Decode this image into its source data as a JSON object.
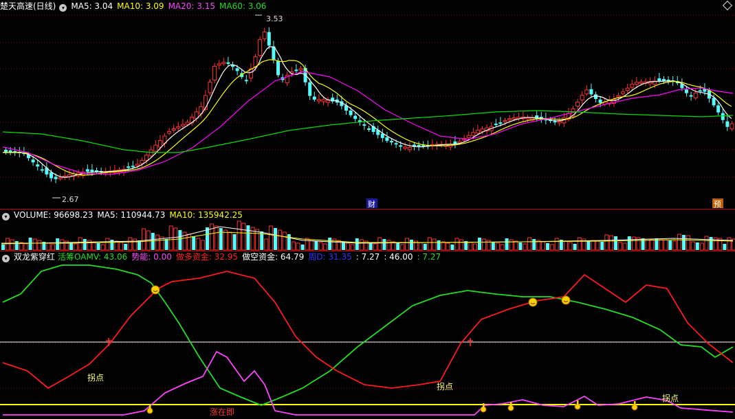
{
  "main_header": {
    "title": "楚天高速(日线)",
    "ma5": "MA5: 3.04",
    "ma10": "MA10: 3.09",
    "ma20": "MA20: 3.15",
    "ma60": "MA60: 3.06"
  },
  "volume_header": {
    "label": "VOLUME: 96698.23",
    "ma5": "MA5: 110944.73",
    "ma10": "MA10: 135942.25"
  },
  "indicator_header": {
    "name": "双龙紫穿红",
    "active": "活筹OAMV: 43.06",
    "momentum": "势能: 0.00",
    "long_fund": "做多资金: 32.95",
    "short_fund": "做空资金: 64.79",
    "field_d": "周D: 31.35",
    "v1": ": 7.27",
    "v2": ": 46.00",
    "v3": ": 7.27"
  },
  "annotations": {
    "high_label": "3.53",
    "low_label": "2.67",
    "marker_finance": "财",
    "marker_forecast": "预",
    "turn_label": "拐点",
    "zhang_label": "涨在即"
  },
  "colors": {
    "up": "#ff3232",
    "down": "#54fcfc",
    "ma5": "#ffffff",
    "ma10": "#ffff00",
    "ma20": "#ff00ff",
    "ma60": "#00e000",
    "green_line": "#22dd22",
    "red_line": "#ff1a1a",
    "magenta_line": "#ff44ff",
    "yellow_line": "#ffff00"
  },
  "chart_data": [
    {
      "type": "candlestick",
      "title": "楚天高速(日线)",
      "ylim": [
        2.55,
        3.6
      ],
      "series": [
        {
          "name": "MA5",
          "value": 3.04
        },
        {
          "name": "MA10",
          "value": 3.09
        },
        {
          "name": "MA20",
          "value": 3.15
        },
        {
          "name": "MA60",
          "value": 3.06
        }
      ],
      "extremes": {
        "high": 3.53,
        "low": 2.67
      }
    },
    {
      "type": "bar",
      "title": "VOLUME",
      "series": [
        {
          "name": "VOLUME",
          "value": 96698.23
        },
        {
          "name": "MA5",
          "value": 110944.73
        },
        {
          "name": "MA10",
          "value": 135942.25
        }
      ]
    },
    {
      "type": "line",
      "title": "双龙紫穿红",
      "series": [
        {
          "name": "活筹OAMV",
          "value": 43.06
        },
        {
          "name": "势能",
          "value": 0.0
        },
        {
          "name": "做多资金",
          "value": 32.95
        },
        {
          "name": "做空资金",
          "value": 64.79
        },
        {
          "name": "周D",
          "value": 31.35
        }
      ]
    }
  ]
}
